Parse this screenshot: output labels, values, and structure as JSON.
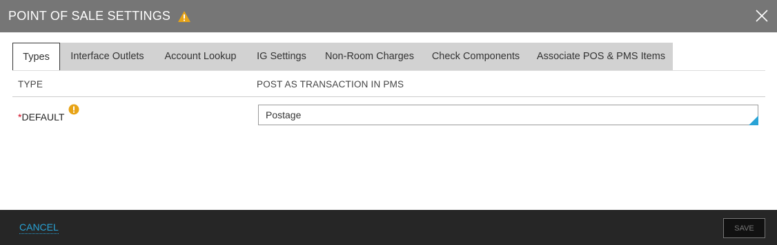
{
  "dialog": {
    "title": "POINT OF SALE SETTINGS",
    "title_icon": "warning-icon",
    "close_icon": "close-icon"
  },
  "tabs": [
    {
      "label": "Types",
      "active": true
    },
    {
      "label": "Interface Outlets",
      "active": false
    },
    {
      "label": "Account Lookup",
      "active": false
    },
    {
      "label": "IG Settings",
      "active": false
    },
    {
      "label": "Non-Room Charges",
      "active": false
    },
    {
      "label": "Check Components",
      "active": false
    },
    {
      "label": "Associate POS & PMS Items",
      "active": false
    }
  ],
  "table": {
    "columns": [
      "TYPE",
      "POST AS TRANSACTION IN PMS"
    ],
    "rows": [
      {
        "required_marker": "*",
        "type": "DEFAULT",
        "info_icon": "info-icon",
        "value": "Postage"
      }
    ]
  },
  "footer": {
    "cancel_label": "CANCEL",
    "save_label": "SAVE"
  },
  "colors": {
    "titlebar": "#767676",
    "footer": "#262626",
    "accent": "#29a3d6",
    "warning": "#e8a417",
    "required": "#d0021b",
    "tab_strip": "#d2d2d2"
  }
}
